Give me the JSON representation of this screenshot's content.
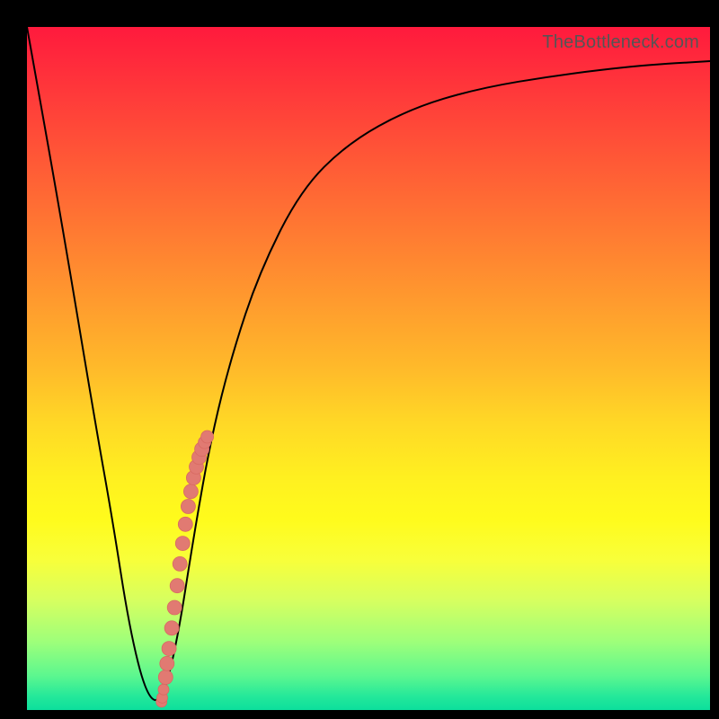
{
  "watermark_text": "TheBottleneck.com",
  "colors": {
    "frame": "#000000",
    "curve": "#000000",
    "dot_fill": "#e17a72",
    "dot_stroke": "#d86a62"
  },
  "chart_data": {
    "type": "line",
    "title": "",
    "xlabel": "",
    "ylabel": "",
    "xlim": [
      0,
      1
    ],
    "ylim": [
      0,
      1
    ],
    "grid": false,
    "legend": false,
    "note": "Axes are unlabeled in the image; x/y normalized to [0,1] with y=0 at bottom.",
    "series": [
      {
        "name": "bottleneck_curve",
        "x": [
          0.0,
          0.05,
          0.1,
          0.125,
          0.15,
          0.175,
          0.197,
          0.22,
          0.245,
          0.27,
          0.3,
          0.34,
          0.4,
          0.47,
          0.56,
          0.66,
          0.78,
          0.9,
          1.0
        ],
        "y": [
          1.0,
          0.72,
          0.42,
          0.28,
          0.12,
          0.02,
          0.01,
          0.1,
          0.26,
          0.4,
          0.52,
          0.64,
          0.76,
          0.83,
          0.88,
          0.91,
          0.93,
          0.944,
          0.95
        ]
      },
      {
        "name": "sample_points",
        "style": "scatter",
        "x": [
          0.197,
          0.198,
          0.2,
          0.203,
          0.205,
          0.208,
          0.212,
          0.216,
          0.22,
          0.224,
          0.228,
          0.232,
          0.236,
          0.24,
          0.244,
          0.248,
          0.252,
          0.256,
          0.26,
          0.264
        ],
        "y": [
          0.012,
          0.018,
          0.03,
          0.048,
          0.068,
          0.09,
          0.12,
          0.15,
          0.182,
          0.214,
          0.244,
          0.272,
          0.298,
          0.32,
          0.34,
          0.356,
          0.37,
          0.382,
          0.392,
          0.4
        ]
      }
    ]
  }
}
